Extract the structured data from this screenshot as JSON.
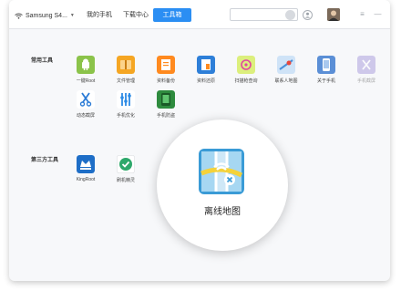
{
  "header": {
    "device_name": "Samsung S4...",
    "tabs": [
      {
        "label": "我的手机",
        "active": false
      },
      {
        "label": "下载中心",
        "active": false
      },
      {
        "label": "工具箱",
        "active": true
      }
    ],
    "search": {
      "placeholder": "",
      "value": ""
    },
    "icons": [
      "wifi-icon",
      "chevron-down-icon",
      "search-icon",
      "user-icon",
      "avatar",
      "menu-icon",
      "minimize-icon"
    ]
  },
  "sections": {
    "common": {
      "title": "常用工具",
      "apps": [
        {
          "label": "一键Root",
          "color": "#8bc34a",
          "icon": "android-icon"
        },
        {
          "label": "文件管理",
          "color": "#f5a623",
          "icon": "folder-icon"
        },
        {
          "label": "资料备份",
          "color": "#ff8a1f",
          "icon": "backup-icon"
        },
        {
          "label": "资料还原",
          "color": "#2e7fd8",
          "icon": "restore-icon"
        },
        {
          "label": "扫描枪查询",
          "color": "#dcef7d",
          "icon": "scan-icon"
        },
        {
          "label": "联系人地图",
          "color": "#4a90d9",
          "icon": "contact-map-icon"
        },
        {
          "label": "关于手机",
          "color": "#5b8fd6",
          "icon": "phone-info-icon"
        },
        {
          "label": "手机截屏",
          "color": "#9e8fd8",
          "icon": "screenshot-icon"
        },
        {
          "label": "动态截屏",
          "color": "#2b7bd6",
          "icon": "scissors-icon"
        },
        {
          "label": "手机优化",
          "color": "#2d8be5",
          "icon": "optimize-icon"
        },
        {
          "label": "手机防盗",
          "color": "#2e8b3e",
          "icon": "anti-theft-icon"
        }
      ]
    },
    "third_party": {
      "title": "第三方工具",
      "apps": [
        {
          "label": "KingRoot",
          "color": "#1e6ec7",
          "icon": "kingroot-icon"
        },
        {
          "label": "刷机精灵",
          "color": "#2ea86b",
          "icon": "flash-icon"
        }
      ]
    }
  },
  "zoom_popup": {
    "label": "离线地图",
    "icon": "offline-map-icon",
    "color": "#3a9bd6"
  }
}
